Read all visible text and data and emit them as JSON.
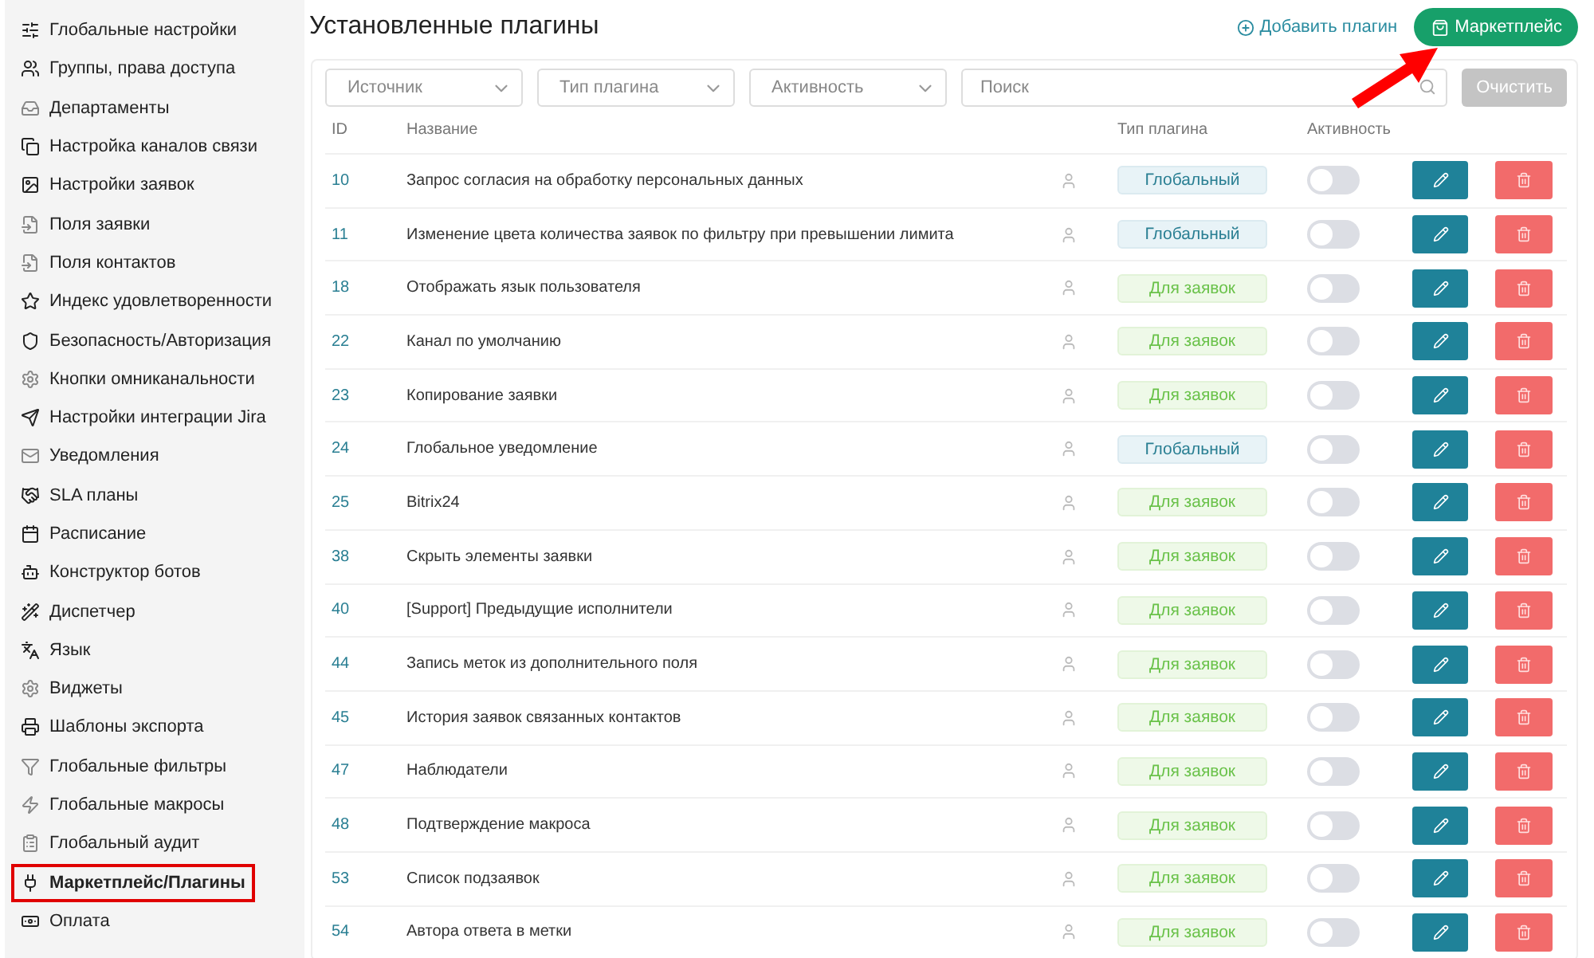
{
  "sidebar": {
    "items": [
      {
        "label": "Глобальные настройки",
        "selected": false
      },
      {
        "label": "Группы, права доступа",
        "selected": false
      },
      {
        "label": "Департаменты",
        "selected": false
      },
      {
        "label": "Настройка каналов связи",
        "selected": false
      },
      {
        "label": "Настройки заявок",
        "selected": false
      },
      {
        "label": "Поля заявки",
        "selected": false
      },
      {
        "label": "Поля контактов",
        "selected": false
      },
      {
        "label": "Индекс удовлетворенности",
        "selected": false
      },
      {
        "label": "Безопасность/Авторизация",
        "selected": false
      },
      {
        "label": "Кнопки омниканальности",
        "selected": false
      },
      {
        "label": "Настройки интеграции Jira",
        "selected": false
      },
      {
        "label": "Уведомления",
        "selected": false
      },
      {
        "label": "SLA планы",
        "selected": false
      },
      {
        "label": "Расписание",
        "selected": false
      },
      {
        "label": "Конструктор ботов",
        "selected": false
      },
      {
        "label": "Диспетчер",
        "selected": false
      },
      {
        "label": "Язык",
        "selected": false
      },
      {
        "label": "Виджеты",
        "selected": false
      },
      {
        "label": "Шаблоны экспорта",
        "selected": false
      },
      {
        "label": "Глобальные фильтры",
        "selected": false
      },
      {
        "label": "Глобальные макросы",
        "selected": false
      },
      {
        "label": "Глобальный аудит",
        "selected": false
      },
      {
        "label": "Маркетплейс/Плагины",
        "selected": true
      },
      {
        "label": "Оплата",
        "selected": false
      }
    ]
  },
  "page": {
    "title": "Установленные плагины",
    "add_link": "Добавить плагин",
    "marketplace_button": "Маркетплейс"
  },
  "filters": {
    "source": {
      "placeholder": "Источник"
    },
    "type": {
      "placeholder": "Тип плагина"
    },
    "activity": {
      "placeholder": "Активность"
    },
    "search": {
      "placeholder": "Поиск"
    },
    "clear_button": "Очистить"
  },
  "table": {
    "columns": [
      "ID",
      "Название",
      "Тип плагина",
      "Активность"
    ],
    "rows": [
      {
        "id": "10",
        "name": "Запрос согласия на обработку персональных данных",
        "type": "Глобальный",
        "kind": "global",
        "on": false
      },
      {
        "id": "11",
        "name": "Изменение цвета количества заявок по фильтру при превышении лимита",
        "type": "Глобальный",
        "kind": "global",
        "on": false
      },
      {
        "id": "18",
        "name": "Отображать язык пользователя",
        "type": "Для заявок",
        "kind": "ticket",
        "on": false
      },
      {
        "id": "22",
        "name": "Канал по умолчанию",
        "type": "Для заявок",
        "kind": "ticket",
        "on": false
      },
      {
        "id": "23",
        "name": "Копирование заявки",
        "type": "Для заявок",
        "kind": "ticket",
        "on": false
      },
      {
        "id": "24",
        "name": "Глобальное уведомление",
        "type": "Глобальный",
        "kind": "global",
        "on": false
      },
      {
        "id": "25",
        "name": "Bitrix24",
        "type": "Для заявок",
        "kind": "ticket",
        "on": false
      },
      {
        "id": "38",
        "name": "Скрыть элементы заявки",
        "type": "Для заявок",
        "kind": "ticket",
        "on": false
      },
      {
        "id": "40",
        "name": "[Support] Предыдущие исполнители",
        "type": "Для заявок",
        "kind": "ticket",
        "on": false
      },
      {
        "id": "44",
        "name": "Запись меток из дополнительного поля",
        "type": "Для заявок",
        "kind": "ticket",
        "on": false
      },
      {
        "id": "45",
        "name": "История заявок связанных контактов",
        "type": "Для заявок",
        "kind": "ticket",
        "on": false
      },
      {
        "id": "47",
        "name": "Наблюдатели",
        "type": "Для заявок",
        "kind": "ticket",
        "on": false
      },
      {
        "id": "48",
        "name": "Подтверждение макроса",
        "type": "Для заявок",
        "kind": "ticket",
        "on": false
      },
      {
        "id": "53",
        "name": "Список подзаявок",
        "type": "Для заявок",
        "kind": "ticket",
        "on": false
      },
      {
        "id": "54",
        "name": "Автора ответа в метки",
        "type": "Для заявок",
        "kind": "ticket",
        "on": false
      }
    ]
  }
}
